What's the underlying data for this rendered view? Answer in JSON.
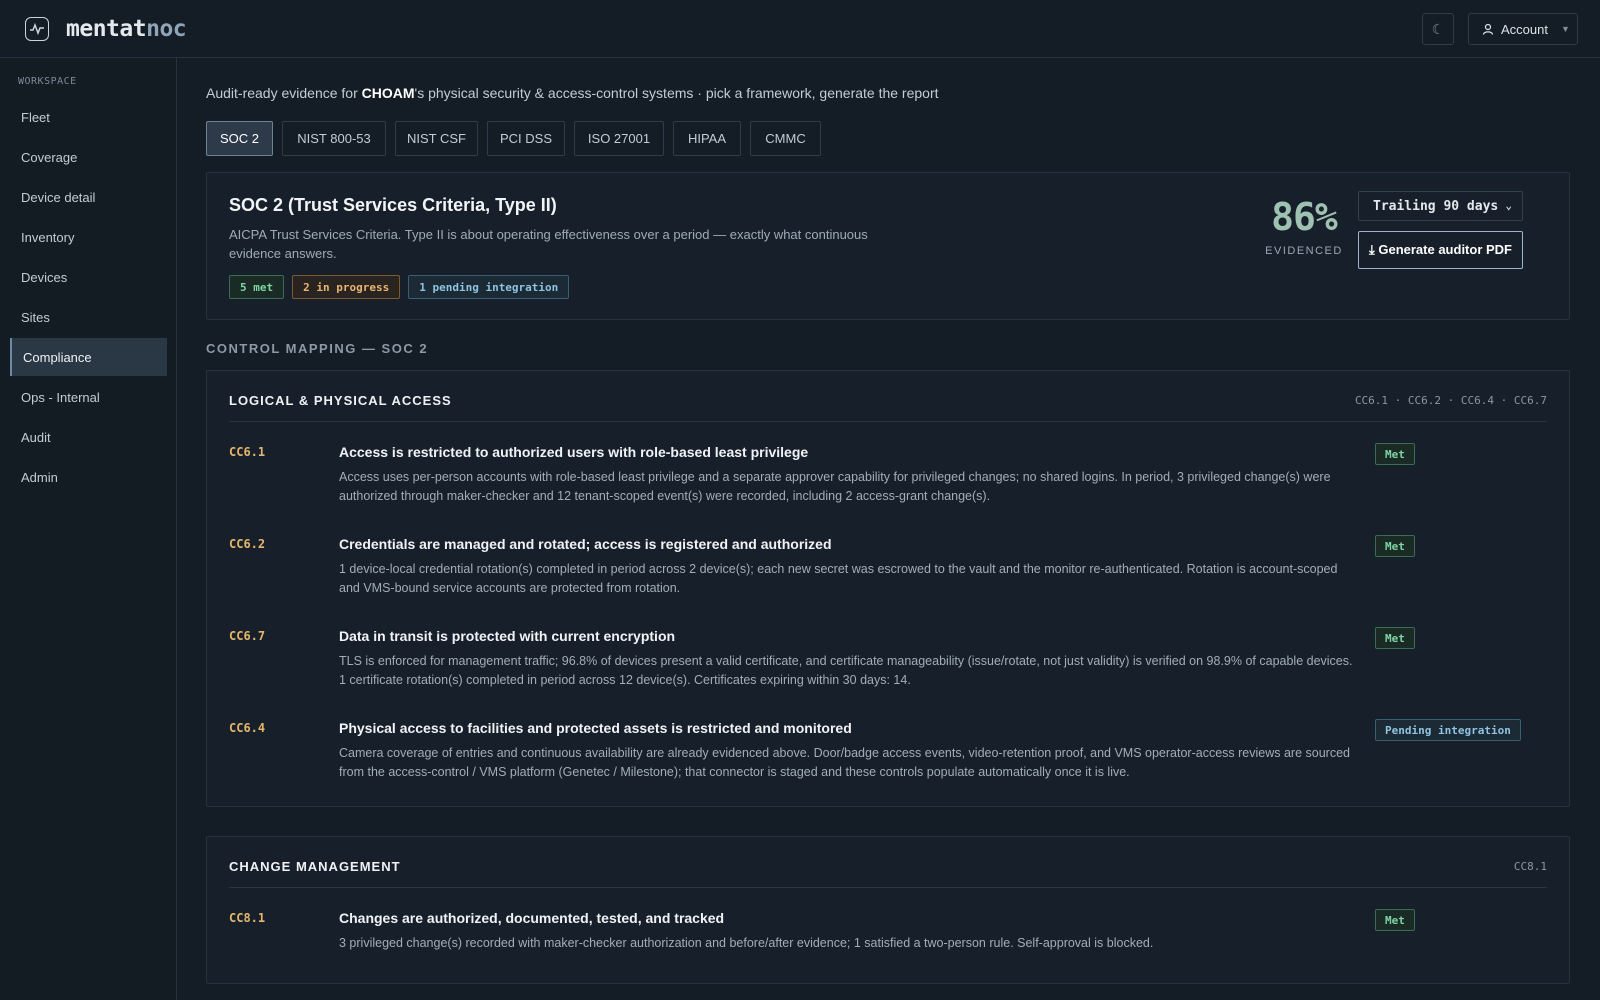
{
  "app": {
    "brand_part1": "mentat",
    "brand_part2": "noc",
    "theme_icon": "☾",
    "account_label": "Account"
  },
  "sidebar": {
    "heading": "WORKSPACE",
    "items": [
      {
        "label": "Fleet"
      },
      {
        "label": "Coverage"
      },
      {
        "label": "Device detail"
      },
      {
        "label": "Inventory"
      },
      {
        "label": "Devices"
      },
      {
        "label": "Sites"
      },
      {
        "label": "Compliance",
        "active": true
      },
      {
        "label": "Ops - Internal"
      },
      {
        "label": "Audit"
      },
      {
        "label": "Admin"
      }
    ]
  },
  "intro": {
    "prefix": "Audit-ready evidence for ",
    "tenant": "CHOAM",
    "suffix": "'s physical security & access-control systems · pick a framework, generate the report"
  },
  "tabs": [
    {
      "label": "SOC 2",
      "active": true
    },
    {
      "label": "NIST 800-53"
    },
    {
      "label": "NIST CSF"
    },
    {
      "label": "PCI DSS"
    },
    {
      "label": "ISO 27001"
    },
    {
      "label": "HIPAA"
    },
    {
      "label": "CMMC"
    }
  ],
  "summary": {
    "title": "SOC 2 (Trust Services Criteria, Type II)",
    "description": "AICPA Trust Services Criteria. Type II is about operating effectiveness over a period — exactly what continuous evidence answers.",
    "badges": {
      "met": "5 met",
      "in_progress": "2 in progress",
      "pending": "1 pending integration"
    },
    "percent": "86%",
    "percent_label": "EVIDENCED",
    "period": "Trailing 90 days",
    "generate_label": "⤓ Generate auditor PDF"
  },
  "mapping_heading": "CONTROL MAPPING — SOC 2",
  "groups": [
    {
      "title": "LOGICAL & PHYSICAL ACCESS",
      "codes": "CC6.1 · CC6.2 · CC6.4 · CC6.7",
      "controls": [
        {
          "code": "CC6.1",
          "title": "Access is restricted to authorized users with role-based least privilege",
          "description": "Access uses per-person accounts with role-based least privilege and a separate approver capability for privileged changes; no shared logins. In period, 3 privileged change(s) were authorized through maker-checker and 12 tenant-scoped event(s) were recorded, including 2 access-grant change(s).",
          "status": "Met"
        },
        {
          "code": "CC6.2",
          "title": "Credentials are managed and rotated; access is registered and authorized",
          "description": "1 device-local credential rotation(s) completed in period across 2 device(s); each new secret was escrowed to the vault and the monitor re-authenticated. Rotation is account-scoped and VMS-bound service accounts are protected from rotation.",
          "status": "Met"
        },
        {
          "code": "CC6.7",
          "title": "Data in transit is protected with current encryption",
          "description": "TLS is enforced for management traffic; 96.8% of devices present a valid certificate, and certificate manageability (issue/rotate, not just validity) is verified on 98.9% of capable devices. 1 certificate rotation(s) completed in period across 12 device(s). Certificates expiring within 30 days: 14.",
          "status": "Met"
        },
        {
          "code": "CC6.4",
          "title": "Physical access to facilities and protected assets is restricted and monitored",
          "description": "Camera coverage of entries and continuous availability are already evidenced above. Door/badge access events, video-retention proof, and VMS operator-access reviews are sourced from the access-control / VMS platform (Genetec / Milestone); that connector is staged and these controls populate automatically once it is live.",
          "status": "Pending integration"
        }
      ]
    },
    {
      "title": "CHANGE MANAGEMENT",
      "codes": "CC8.1",
      "controls": [
        {
          "code": "CC8.1",
          "title": "Changes are authorized, documented, tested, and tracked",
          "description": "3 privileged change(s) recorded with maker-checker authorization and before/after evidence; 1 satisfied a two-person rule. Self-approval is blocked.",
          "status": "Met"
        }
      ]
    }
  ]
}
